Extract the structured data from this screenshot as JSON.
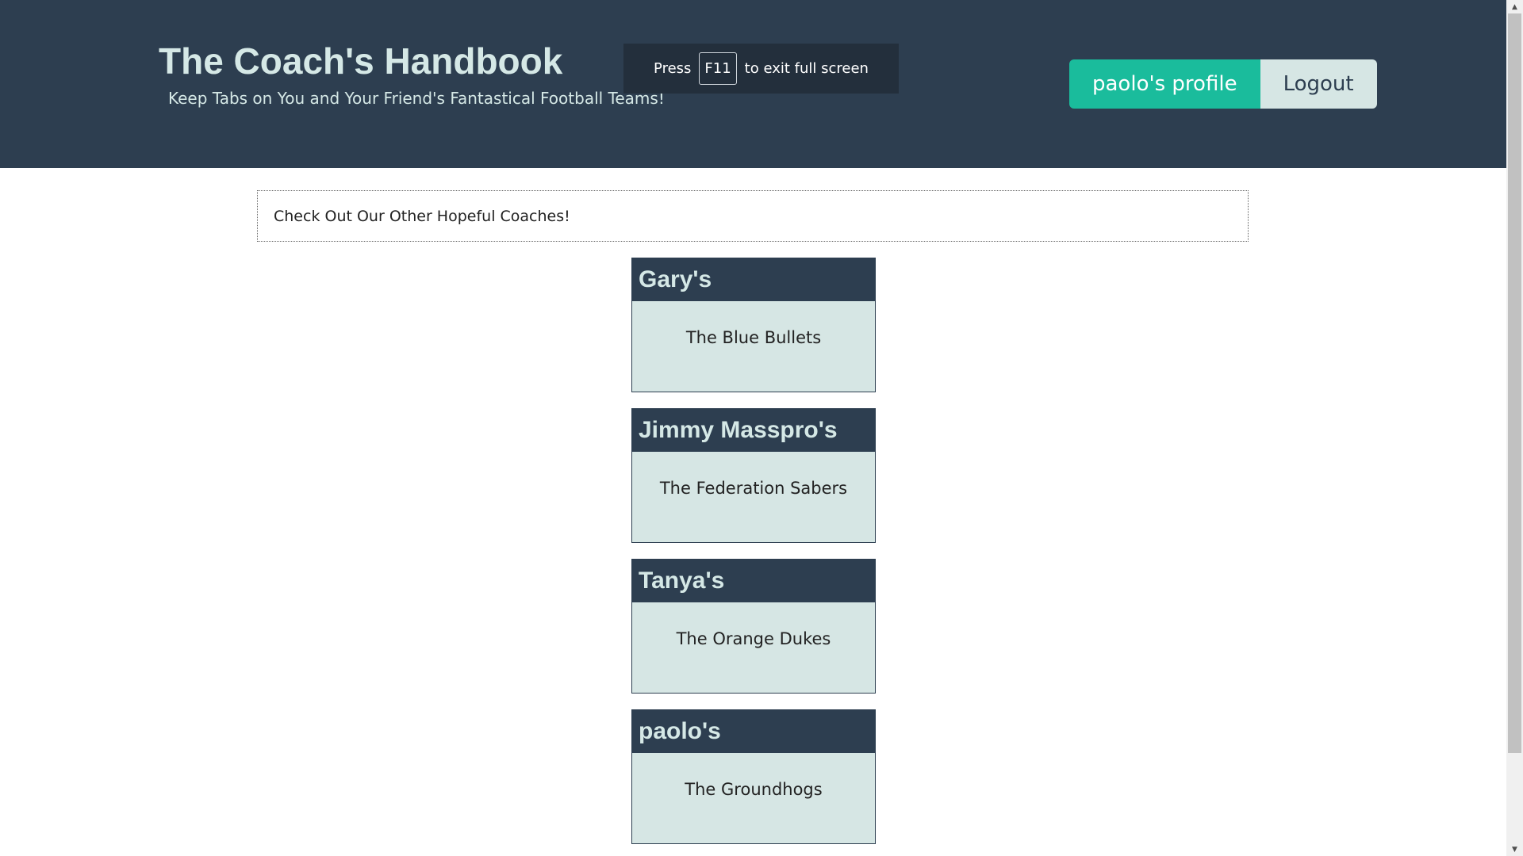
{
  "header": {
    "title": "The Coach's Handbook",
    "subtitle": "Keep Tabs on You and Your Friend's Fantastical Football Teams!",
    "profile_button": "paolo's profile",
    "logout_button": "Logout"
  },
  "fullscreen_notice": {
    "before": "Press",
    "key": "F11",
    "after": "to exit full screen"
  },
  "banner": {
    "text": "Check Out Our Other Hopeful Coaches!"
  },
  "coaches": [
    {
      "owner": "Gary's",
      "team": "The Blue Bullets"
    },
    {
      "owner": "Jimmy Masspro's",
      "team": "The Federation Sabers"
    },
    {
      "owner": "Tanya's",
      "team": "The Orange Dukes"
    },
    {
      "owner": "paolo's",
      "team": "The Groundhogs"
    }
  ],
  "colors": {
    "header_bg": "#2d3e50",
    "accent": "#1abc9c",
    "card_bg": "#d6e6e4",
    "title_text": "#d5e8e6"
  }
}
